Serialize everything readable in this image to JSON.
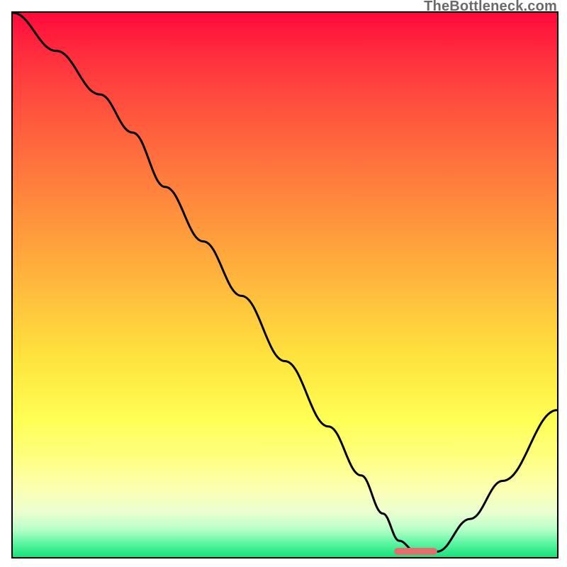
{
  "attribution": "TheBottleneck.com",
  "colors": {
    "curve": "#000000",
    "marker": "#e66d6d",
    "border": "#000000",
    "gradient_top": "#ff0a3b",
    "gradient_mid": "#ffe23d",
    "gradient_bottom": "#18e27b"
  },
  "chart_data": {
    "type": "line",
    "title": "",
    "xlabel": "",
    "ylabel": "",
    "xlim": [
      0,
      100
    ],
    "ylim": [
      0,
      100
    ],
    "grid": false,
    "note": "Axis is unlabeled in source; values are percent of plot area. y=100 at top of frame, y=0 at bottom edge. Curve reaches minimum near x≈73 and rises again toward x=100.",
    "series": [
      {
        "name": "bottleneck-curve",
        "x": [
          0,
          8,
          16,
          22,
          28,
          35,
          42,
          50,
          58,
          64,
          68,
          71,
          74,
          78,
          84,
          90,
          100
        ],
        "y": [
          100,
          93,
          85,
          78,
          68,
          58,
          48,
          36,
          24,
          15,
          8,
          3,
          1,
          1,
          7,
          14,
          27
        ]
      }
    ],
    "marker": {
      "name": "optimal-range",
      "x_start": 70,
      "x_end": 78,
      "y": 1
    }
  }
}
